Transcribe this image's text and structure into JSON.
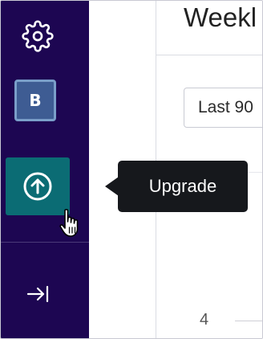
{
  "sidebar": {
    "settings_icon": "gear-icon",
    "avatar_initial": "B",
    "upgrade_icon": "arrow-up-circle-icon",
    "collapse_icon": "expand-right-icon",
    "background_color": "#1d0652",
    "upgrade_color": "#0b6c74"
  },
  "tooltip": {
    "label": "Upgrade"
  },
  "main": {
    "title": "Weekl",
    "date_range_value": "Last 90",
    "axis_tick": "4"
  }
}
